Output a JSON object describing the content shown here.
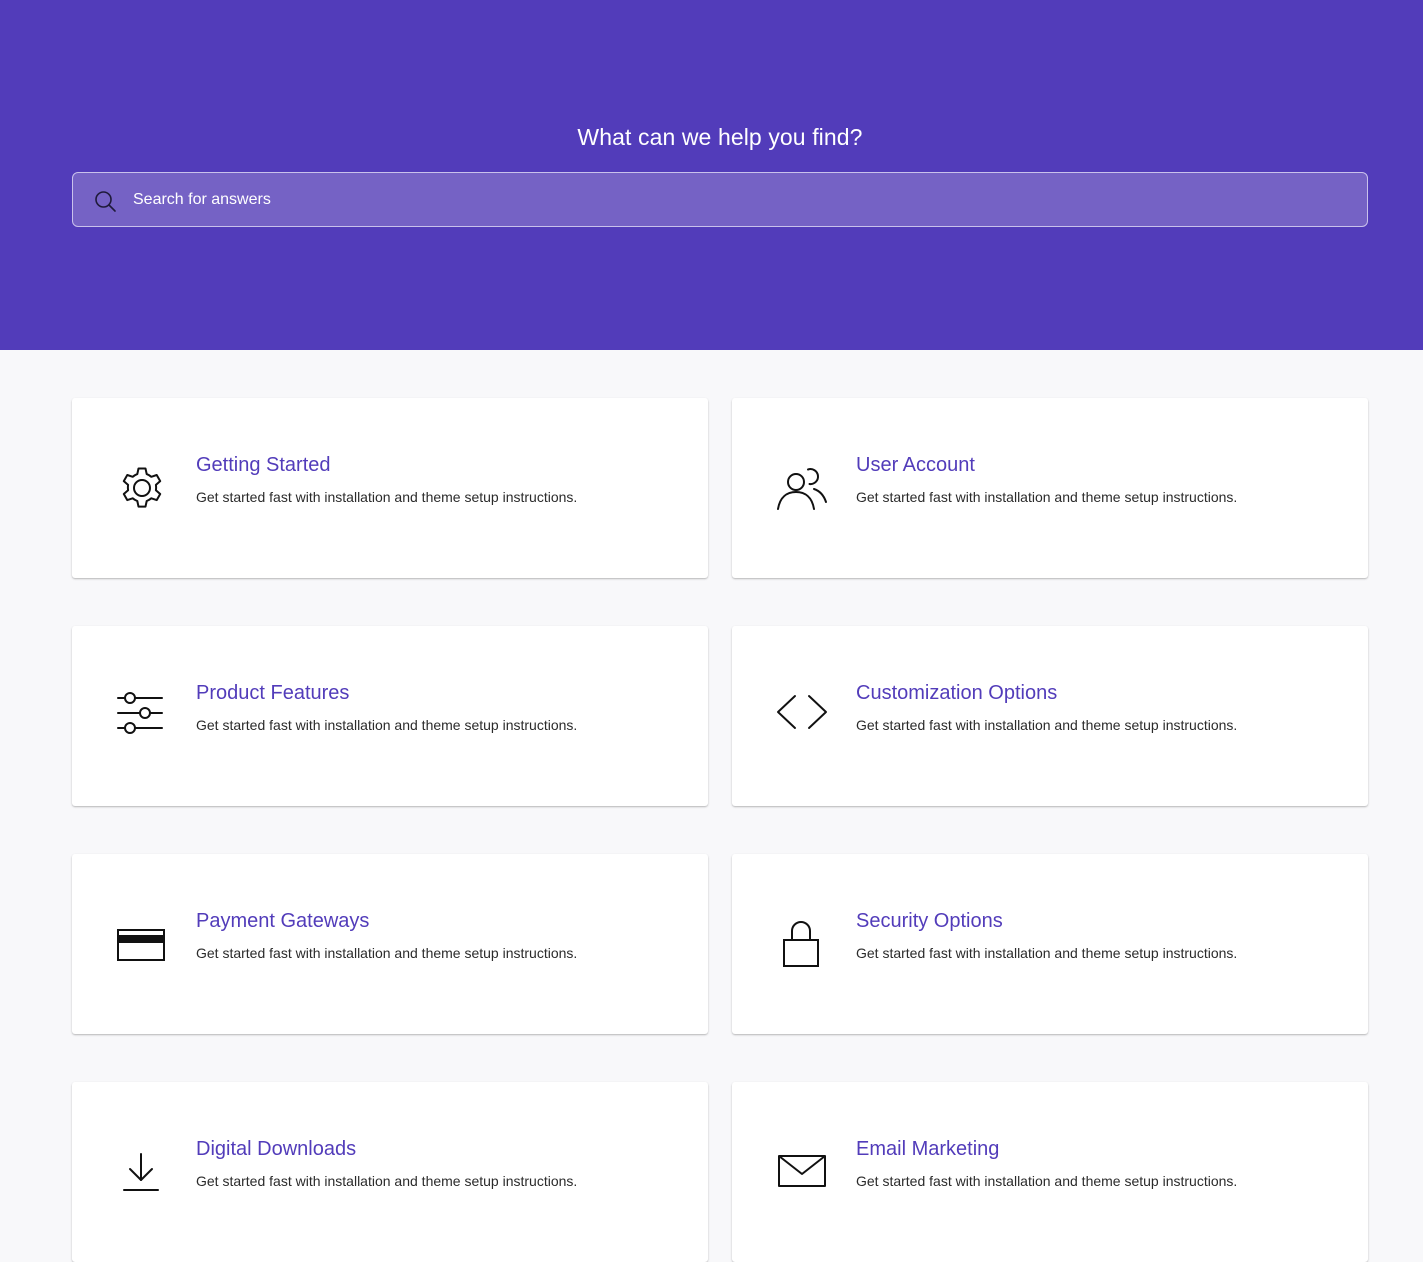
{
  "hero": {
    "title": "What can we help you find?",
    "background_color": "#523cba"
  },
  "search": {
    "placeholder": "Search for answers",
    "value": "",
    "icon": "search-icon"
  },
  "categories": [
    {
      "title": "Getting Started",
      "description": "Get started fast with installation and theme setup instructions.",
      "icon": "gear-icon"
    },
    {
      "title": "User Account",
      "description": "Get started fast with installation and theme setup instructions.",
      "icon": "users-icon"
    },
    {
      "title": "Product Features",
      "description": "Get started fast with installation and theme setup instructions.",
      "icon": "sliders-icon"
    },
    {
      "title": "Customization Options",
      "description": "Get started fast with installation and theme setup instructions.",
      "icon": "code-icon"
    },
    {
      "title": "Payment Gateways",
      "description": "Get started fast with installation and theme setup instructions.",
      "icon": "credit-card-icon"
    },
    {
      "title": "Security Options",
      "description": "Get started fast with installation and theme setup instructions.",
      "icon": "lock-icon"
    },
    {
      "title": "Digital Downloads",
      "description": "Get started fast with installation and theme setup instructions.",
      "icon": "download-icon"
    },
    {
      "title": "Email Marketing",
      "description": "Get started fast with installation and theme setup instructions.",
      "icon": "envelope-icon"
    }
  ],
  "colors": {
    "accent": "#523cba",
    "search_background": "#7562c5",
    "page_background": "#f8f8fa",
    "card_background": "#ffffff"
  }
}
